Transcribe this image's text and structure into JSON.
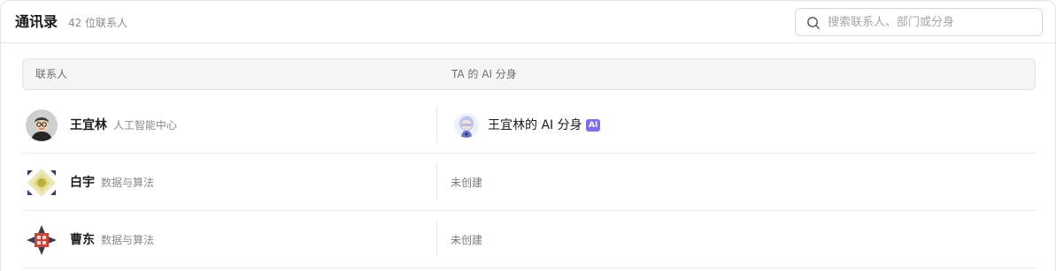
{
  "header": {
    "title": "通讯录",
    "subtitle": "42 位联系人"
  },
  "search": {
    "placeholder": "搜索联系人、部门或分身",
    "value": "",
    "icon": "search-icon"
  },
  "table": {
    "columns": [
      "联系人",
      "TA 的 AI 分身"
    ],
    "rows": [
      {
        "name": "王宜林",
        "department": "人工智能中心",
        "avatar_icon": "cartoon-person-glasses-avatar",
        "ai_twin": {
          "name": "王宜林的 AI 分身",
          "badge": "AI",
          "avatar_icon": "ai-twin-robot-avatar"
        }
      },
      {
        "name": "白宇",
        "department": "数据与算法",
        "avatar_icon": "geometric-yellow-pattern-avatar",
        "ai_twin": {
          "status": "未创建"
        }
      },
      {
        "name": "曹东",
        "department": "数据与算法",
        "avatar_icon": "geometric-red-pattern-avatar",
        "ai_twin": {
          "status": "未创建"
        }
      }
    ]
  },
  "colors": {
    "ai_badge": "#7b6ff0",
    "header_bg": "#f5f5f5",
    "muted_text": "#8a8a8a"
  }
}
